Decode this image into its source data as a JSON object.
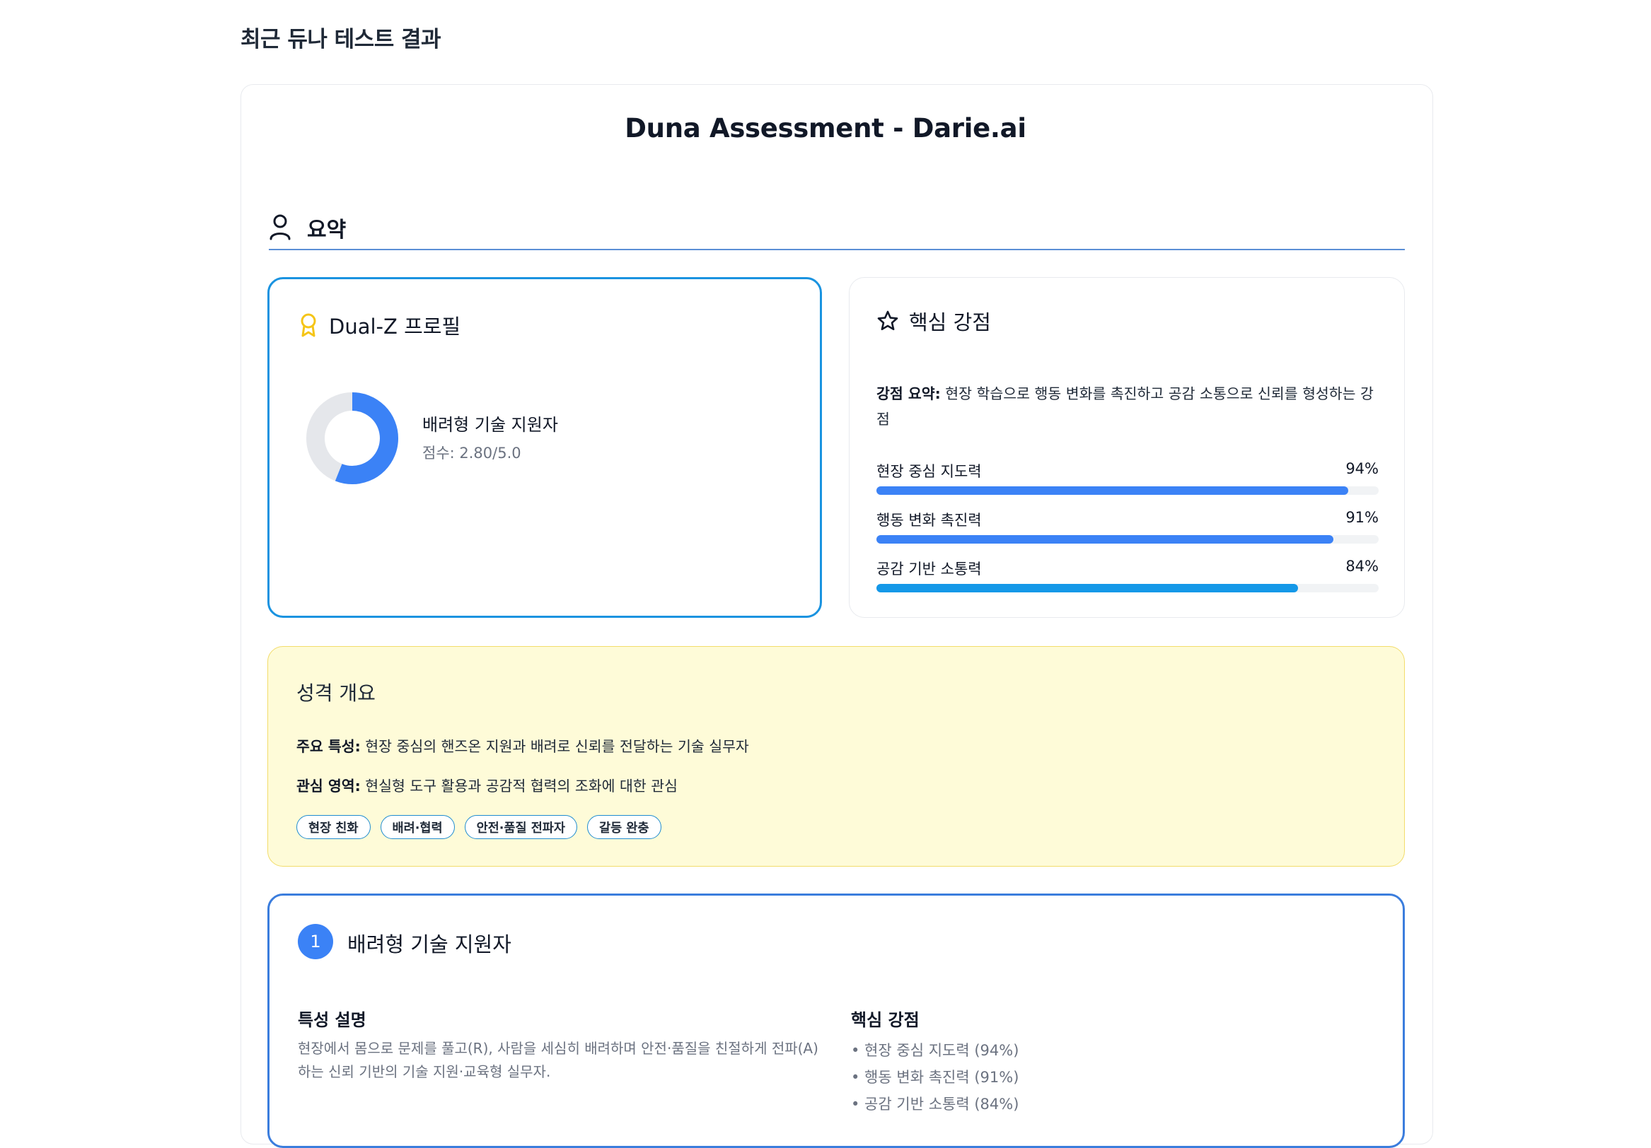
{
  "page": {
    "heading": "최근 듀나 테스트 결과"
  },
  "report": {
    "title": "Duna Assessment - Darie.ai"
  },
  "summary_section": {
    "title": "요약",
    "icon": "user-icon"
  },
  "profile_card": {
    "title": "Dual-Z 프로필",
    "icon": "award-icon",
    "type_name": "배려형 기술 지원자",
    "score_text": "점수: 2.80/5.0",
    "score": 2.8,
    "score_max": 5.0,
    "accent_color": "#3b82f6",
    "border_color": "#1a93e0"
  },
  "strength_card": {
    "title": "핵심 강점",
    "icon": "star-icon",
    "summary_label": "강점 요약:",
    "summary_text": " 현장 학습으로 행동 변화를 촉진하고 공감 소통으로 신뢰를 형성하는 강점",
    "bars": [
      {
        "label": "현장 중심 지도력",
        "pct_text": "94%",
        "value": 0.94,
        "color": "#3b82f6"
      },
      {
        "label": "행동 변화 촉진력",
        "pct_text": "91%",
        "value": 0.91,
        "color": "#3b82f6"
      },
      {
        "label": "공감 기반 소통력",
        "pct_text": "84%",
        "value": 0.84,
        "color": "#1498e8"
      }
    ]
  },
  "overview_card": {
    "title": "성격 개요",
    "traits_label": "주요 특성:",
    "traits_text": " 현장 중심의 핸즈온 지원과 배려로 신뢰를 전달하는 기술 실무자",
    "interests_label": "관심 영역:",
    "interests_text": " 현실형 도구 활용과 공감적 협력의 조화에 대한 관심",
    "tags": [
      "현장 친화",
      "배려·협력",
      "안전·품질 전파자",
      "갈등 완충"
    ],
    "background_color": "#fefbd8"
  },
  "type_card": {
    "number": "1",
    "title": "배려형 기술 지원자",
    "desc_title": "특성 설명",
    "desc_text": "현장에서 몸으로 문제를 풀고(R), 사람을 세심히 배려하며 안전·품질을 친절하게 전파(A)하는 신뢰 기반의 기술 지원·교육형 실무자.",
    "strengths_title": "핵심 강점",
    "strengths": [
      "• 현장 중심 지도력 (94%)",
      "• 행동 변화 촉진력 (91%)",
      "• 공감 기반 소통력 (84%)"
    ]
  }
}
